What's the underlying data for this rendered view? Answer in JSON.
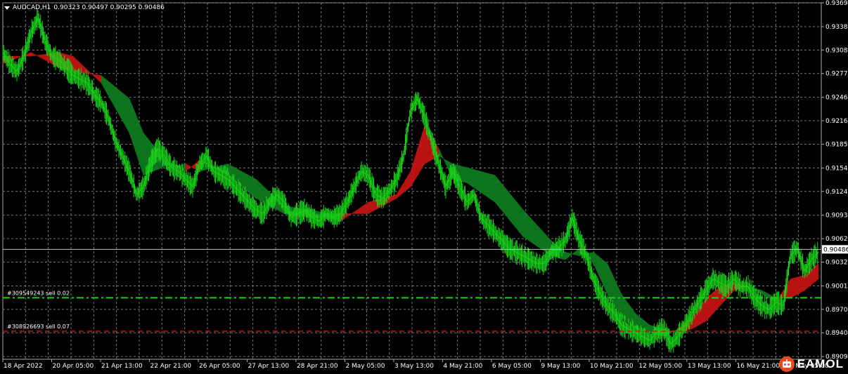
{
  "header": {
    "symbol": "AUDCAD,H1",
    "ohlc": "0.90323 0.90497 0.90295 0.90486"
  },
  "colors": {
    "background": "#000000",
    "grid": "#6e7a7a",
    "price": "#19d219",
    "cloud_bull": "#0f7a1f",
    "cloud_bear": "#c21414",
    "buy_line": "#19d219",
    "sell_line": "#d21919",
    "current_price_line": "#c0c0c0"
  },
  "logo": {
    "text": "EAMOL",
    "icon": "robot-icon"
  },
  "chart_data": {
    "type": "line",
    "title": "AUDCAD,H1",
    "y_axis": {
      "position": "right",
      "ticks": [
        "0.93695",
        "0.93385",
        "0.93080",
        "0.92775",
        "0.92465",
        "0.92160",
        "0.91855",
        "0.91545",
        "0.91240",
        "0.90930",
        "0.90625",
        "0.90320",
        "0.90010",
        "0.89705",
        "0.89400",
        "0.89090"
      ],
      "ylim": [
        0.89055,
        0.93695
      ]
    },
    "x_axis": {
      "ticks": [
        "18 Apr 2022",
        "20 Apr 05:00",
        "21 Apr 13:00",
        "22 Apr 21:00",
        "26 Apr 05:00",
        "27 Apr 13:00",
        "28 Apr 21:00",
        "2 May 05:00",
        "3 May 13:00",
        "4 May 21:00",
        "6 May 05:00",
        "9 May 13:00",
        "10 May 21:00",
        "12 May 05:00",
        "13 May 13:00",
        "16 May 21:00",
        "18 May 05:00"
      ]
    },
    "grid": true,
    "current_price": 0.90486,
    "current_price_label": "0.90486",
    "orders": [
      {
        "label": "#309549243 sell 0.02",
        "price": 0.89855,
        "style": "dash-dot",
        "color": "#19d219"
      },
      {
        "label": "#308926693 sell 0.07",
        "price": 0.8942,
        "style": "dashed",
        "color": "#d21919"
      }
    ],
    "series": [
      {
        "name": "",
        "role": "price",
        "x": [
          0,
          1,
          2,
          3,
          4,
          5,
          6,
          7,
          8,
          9,
          10,
          11,
          12,
          13,
          14,
          15,
          16,
          17,
          18,
          19,
          20,
          21,
          22,
          23,
          24,
          25,
          26,
          27,
          28,
          29,
          30,
          31,
          32,
          33,
          34,
          35,
          36,
          37,
          38,
          39,
          40,
          41,
          42,
          43,
          44,
          45,
          46,
          47,
          48,
          49,
          50,
          51,
          52,
          53,
          54,
          55,
          56,
          57,
          58,
          59,
          60,
          61,
          62,
          63,
          64,
          65,
          66,
          67,
          68,
          69,
          70,
          71,
          72,
          73,
          74,
          75,
          76,
          77,
          78,
          79,
          80,
          81,
          82,
          83,
          84,
          85,
          86,
          87,
          88,
          89,
          90,
          91,
          92,
          93,
          94,
          95,
          96,
          97,
          98,
          99,
          100,
          101,
          102,
          103,
          104,
          105,
          106,
          107,
          108,
          109,
          110,
          111,
          112,
          113,
          114,
          115,
          116
        ],
        "y": [
          0.9305,
          0.929,
          0.928,
          0.93,
          0.933,
          0.935,
          0.932,
          0.93,
          0.9295,
          0.9285,
          0.9275,
          0.927,
          0.9265,
          0.925,
          0.924,
          0.922,
          0.919,
          0.917,
          0.915,
          0.912,
          0.913,
          0.916,
          0.918,
          0.917,
          0.9155,
          0.915,
          0.914,
          0.913,
          0.916,
          0.917,
          0.915,
          0.9145,
          0.914,
          0.913,
          0.912,
          0.911,
          0.91,
          0.9095,
          0.911,
          0.912,
          0.911,
          0.909,
          0.9095,
          0.91,
          0.909,
          0.9085,
          0.9095,
          0.909,
          0.9095,
          0.911,
          0.913,
          0.915,
          0.9145,
          0.912,
          0.9115,
          0.9125,
          0.914,
          0.917,
          0.923,
          0.9245,
          0.922,
          0.919,
          0.916,
          0.913,
          0.915,
          0.913,
          0.911,
          0.912,
          0.909,
          0.908,
          0.907,
          0.906,
          0.905,
          0.9045,
          0.904,
          0.9035,
          0.903,
          0.903,
          0.9045,
          0.905,
          0.906,
          0.909,
          0.906,
          0.904,
          0.901,
          0.899,
          0.8975,
          0.8965,
          0.895,
          0.8945,
          0.894,
          0.8935,
          0.893,
          0.894,
          0.8945,
          0.8925,
          0.8935,
          0.895,
          0.8965,
          0.898,
          0.8995,
          0.901,
          0.9005,
          0.9,
          0.901,
          0.9,
          0.9,
          0.8985,
          0.8975,
          0.897,
          0.898,
          0.8975,
          0.904,
          0.905,
          0.902,
          0.9035,
          0.9045
        ]
      },
      {
        "name": "",
        "role": "ma-fast",
        "x": [
          0,
          4,
          8,
          10,
          14,
          18,
          20,
          24,
          26,
          28,
          32,
          36,
          40,
          44,
          46,
          48,
          52,
          56,
          58,
          60,
          62,
          64,
          66,
          70,
          74,
          78,
          80,
          82,
          84,
          86,
          88,
          90,
          92,
          94,
          96,
          98,
          100,
          102,
          104,
          106,
          108,
          110,
          112,
          114,
          116
        ],
        "y": [
          0.93,
          0.93,
          0.9305,
          0.93,
          0.9265,
          0.92,
          0.9145,
          0.916,
          0.915,
          0.9165,
          0.9145,
          0.9115,
          0.9095,
          0.909,
          0.909,
          0.9085,
          0.911,
          0.912,
          0.915,
          0.921,
          0.918,
          0.914,
          0.9135,
          0.911,
          0.9065,
          0.904,
          0.9035,
          0.905,
          0.903,
          0.899,
          0.896,
          0.8945,
          0.894,
          0.8935,
          0.8945,
          0.896,
          0.8985,
          0.9,
          0.9005,
          0.9,
          0.899,
          0.898,
          0.901,
          0.9015,
          0.903
        ]
      },
      {
        "name": "",
        "role": "ma-slow",
        "x": [
          0,
          4,
          8,
          10,
          14,
          18,
          20,
          24,
          26,
          28,
          32,
          36,
          40,
          44,
          46,
          48,
          52,
          56,
          58,
          60,
          62,
          64,
          66,
          70,
          74,
          78,
          80,
          82,
          84,
          86,
          88,
          90,
          92,
          94,
          96,
          98,
          100,
          102,
          104,
          106,
          108,
          110,
          112,
          114,
          116
        ],
        "y": [
          0.929,
          0.9305,
          0.9285,
          0.928,
          0.9275,
          0.9245,
          0.92,
          0.9155,
          0.916,
          0.915,
          0.916,
          0.914,
          0.9105,
          0.91,
          0.9095,
          0.9095,
          0.9095,
          0.9115,
          0.913,
          0.916,
          0.917,
          0.916,
          0.9155,
          0.9145,
          0.91,
          0.906,
          0.9045,
          0.904,
          0.9045,
          0.903,
          0.899,
          0.8965,
          0.895,
          0.8945,
          0.894,
          0.8945,
          0.8955,
          0.8975,
          0.8995,
          0.9,
          0.8995,
          0.8985,
          0.8985,
          0.8995,
          0.901
        ]
      }
    ]
  }
}
